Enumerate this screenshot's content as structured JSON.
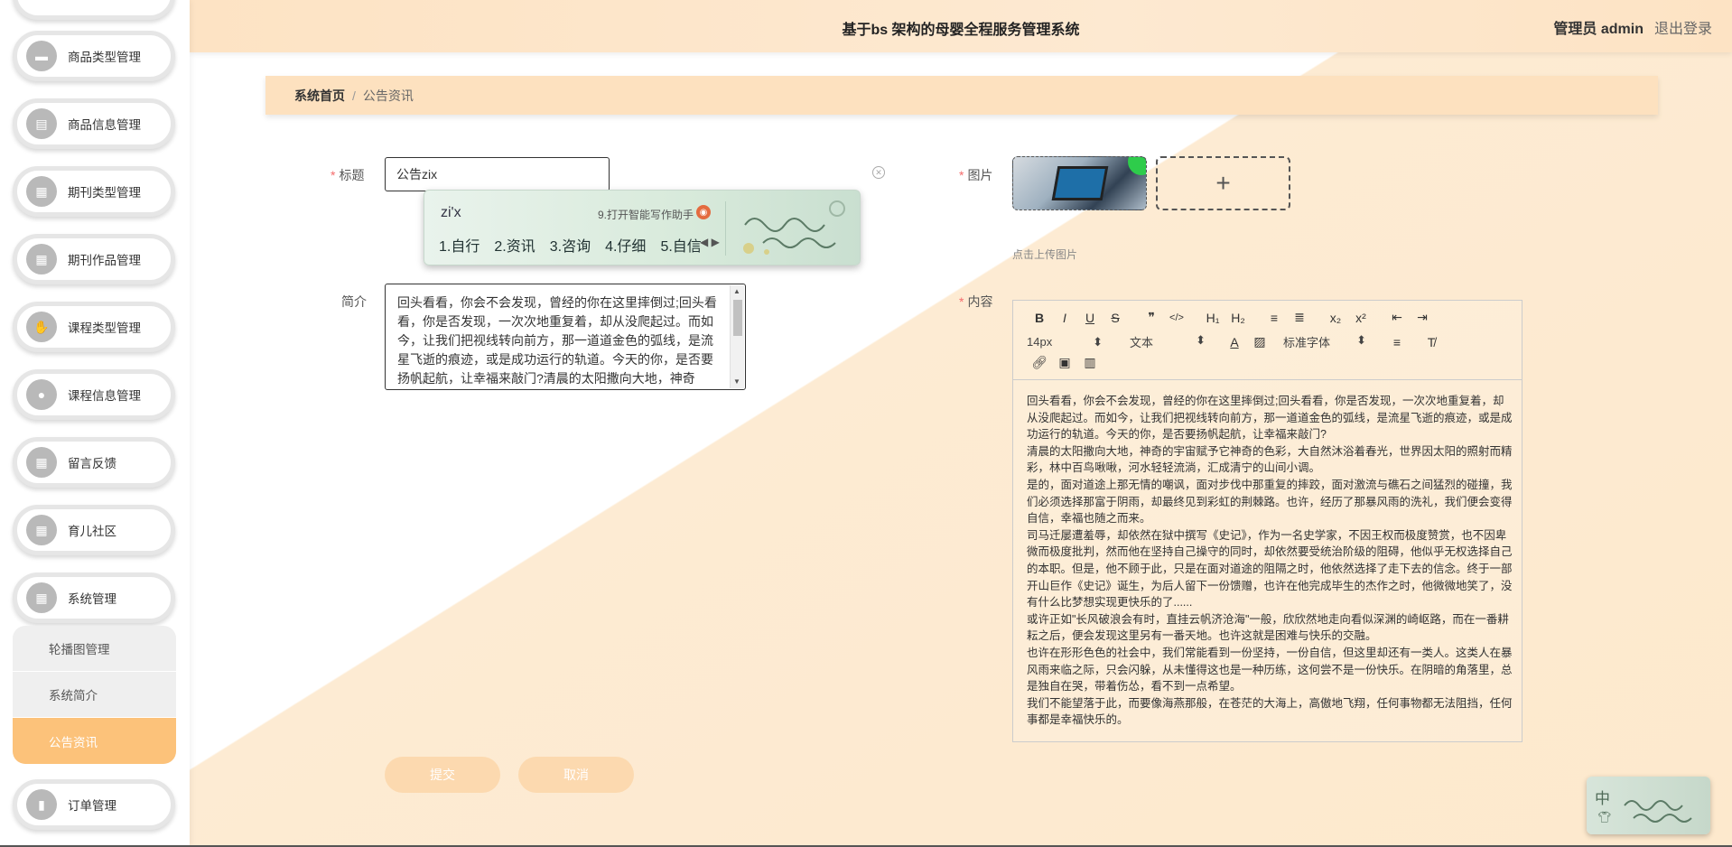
{
  "header": {
    "title": "基于bs 架构的母婴全程服务管理系统",
    "admin_label": "管理员 admin",
    "logout_label": "退出登录"
  },
  "sidebar": {
    "items": [
      {
        "label": "商品类型管理",
        "icon": "tag-icon"
      },
      {
        "label": "商品信息管理",
        "icon": "clipboard-icon"
      },
      {
        "label": "期刊类型管理",
        "icon": "grid-icon"
      },
      {
        "label": "期刊作品管理",
        "icon": "grid-icon"
      },
      {
        "label": "课程类型管理",
        "icon": "thumbs-up-icon"
      },
      {
        "label": "课程信息管理",
        "icon": "user-icon"
      },
      {
        "label": "留言反馈",
        "icon": "grid-icon"
      },
      {
        "label": "育儿社区",
        "icon": "grid-icon"
      },
      {
        "label": "系统管理",
        "icon": "grid-icon"
      },
      {
        "label": "订单管理",
        "icon": "document-icon"
      }
    ],
    "submenu": [
      {
        "label": "轮播图管理"
      },
      {
        "label": "系统简介"
      },
      {
        "label": "公告资讯"
      }
    ]
  },
  "breadcrumb": {
    "home": "系统首页",
    "separator": "/",
    "current": "公告资讯"
  },
  "form": {
    "title_label": "标题",
    "title_value": "公告zix",
    "desc_label": "简介",
    "desc_value": "回头看看，你会不会发现，曾经的你在这里摔倒过;回头看看，你是否发现，一次次地重复着，却从没爬起过。而如今，让我们把视线转向前方，那一道道金色的弧线，是流星飞逝的痕迹，或是成功运行的轨道。今天的你，是否要扬帆起航，让幸福来敲门?清晨的太阳撒向大地，神奇",
    "image_label": "图片",
    "upload_plus": "+",
    "upload_hint": "点击上传图片",
    "content_label": "内容",
    "required_mark": "*",
    "submit_label": "提交",
    "cancel_label": "取消"
  },
  "ime": {
    "pinyin": "zi'x",
    "helper": "9.打开智能写作助手",
    "candidates": [
      "1.自行",
      "2.资讯",
      "3.咨询",
      "4.仔细",
      "5.自信"
    ]
  },
  "editor": {
    "toolbar_row1": [
      "B",
      "I",
      "U",
      "S",
      "❞",
      "</>",
      "H₁",
      "H₂",
      "≡",
      "≣",
      "x₂",
      "x²",
      "⇤",
      "⇥"
    ],
    "font_size": "14px",
    "text_type": "文本",
    "font_family": "标准字体",
    "paragraphs": [
      "回头看看，你会不会发现，曾经的你在这里摔倒过;回头看看，你是否发现，一次次地重复着，却从没爬起过。而如今，让我们把视线转向前方，那一道道金色的弧线，是流星飞逝的痕迹，或是成功运行的轨道。今天的你，是否要扬帆起航，让幸福来敲门?",
      "清晨的太阳撒向大地，神奇的宇宙赋予它神奇的色彩，大自然沐浴着春光，世界因太阳的照射而精彩，林中百鸟啾啾，河水轻轻流淌，汇成清宁的山间小调。",
      "是的，面对道途上那无情的嘲讽，面对步伐中那重复的摔跤，面对激流与礁石之间猛烈的碰撞，我们必须选择那富于阴雨，却最终见到彩虹的荆棘路。也许，经历了那暴风雨的洗礼，我们便会变得自信，幸福也随之而来。",
      "司马迁屡遭羞辱，却依然在狱中撰写《史记》，作为一名史学家，不因王权而极度赞赏，也不因卑微而极度批判，然而他在坚持自己操守的同时，却依然要受统治阶级的阻碍，他似乎无权选择自己的本职。但是，他不顾于此，只是在面对道途的阻隔之时，他依然选择了走下去的信念。终于一部开山巨作《史记》诞生，为后人留下一份馈赠，也许在他完成毕生的杰作之时，他微微地笑了，没有什么比梦想实现更快乐的了......",
      "或许正如\"长风破浪会有时，直挂云帆济沧海\"一般，欣欣然地走向看似深渊的崎岖路，而在一番耕耘之后，便会发现这里另有一番天地。也许这就是困难与快乐的交融。",
      "也许在形形色色的社会中，我们常能看到一份坚持，一份自信，但这里却还有一类人。这类人在暴风雨来临之际，只会闪躲，从未懂得这也是一种历练，这何尝不是一份快乐。在阴暗的角落里，总是独自在哭，带着伤怂，看不到一点希望。",
      "我们不能望落于此，而要像海燕那般，在苍茫的大海上，高傲地飞翔，任何事物都无法阻挡，任何事都是幸福快乐的。"
    ]
  },
  "floating_widget": {
    "mode": "中"
  },
  "colors": {
    "accent": "#fcc27a",
    "header_bg": "#fde3c4",
    "button_bg": "#fcd9af",
    "required": "#f56c6c"
  }
}
